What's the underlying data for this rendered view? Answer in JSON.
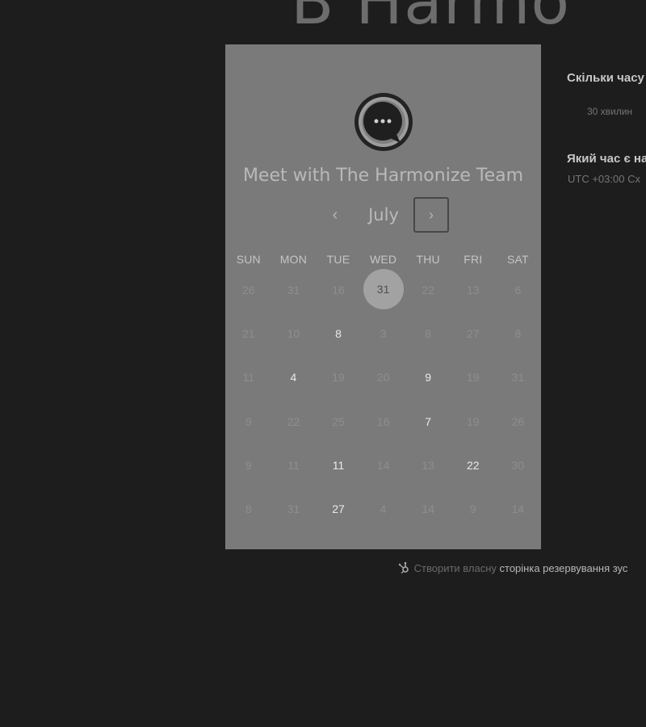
{
  "header": {
    "title_fragment": "B Harmo"
  },
  "widget": {
    "logo_icon": "chat-bubble-icon",
    "title": "Meet with The Harmonize Team",
    "month": "July",
    "prev_icon": "‹",
    "next_icon": "›",
    "weekdays": [
      "SUN",
      "MON",
      "TUE",
      "WED",
      "THU",
      "FRI",
      "SAT"
    ],
    "weeks": [
      [
        {
          "d": "26",
          "state": "disabled"
        },
        {
          "d": "31",
          "state": "disabled"
        },
        {
          "d": "16",
          "state": "disabled"
        },
        {
          "d": "31",
          "state": "selected"
        },
        {
          "d": "22",
          "state": "disabled"
        },
        {
          "d": "13",
          "state": "disabled"
        },
        {
          "d": "6",
          "state": "disabled"
        }
      ],
      [
        {
          "d": "21",
          "state": "disabled"
        },
        {
          "d": "10",
          "state": "disabled"
        },
        {
          "d": "8",
          "state": "available"
        },
        {
          "d": "3",
          "state": "disabled"
        },
        {
          "d": "8",
          "state": "disabled"
        },
        {
          "d": "27",
          "state": "disabled"
        },
        {
          "d": "8",
          "state": "disabled"
        }
      ],
      [
        {
          "d": "11",
          "state": "disabled"
        },
        {
          "d": "4",
          "state": "available"
        },
        {
          "d": "19",
          "state": "disabled"
        },
        {
          "d": "20",
          "state": "disabled"
        },
        {
          "d": "9",
          "state": "available"
        },
        {
          "d": "19",
          "state": "disabled"
        },
        {
          "d": "31",
          "state": "disabled"
        }
      ],
      [
        {
          "d": "9",
          "state": "disabled"
        },
        {
          "d": "22",
          "state": "disabled"
        },
        {
          "d": "25",
          "state": "disabled"
        },
        {
          "d": "16",
          "state": "disabled"
        },
        {
          "d": "7",
          "state": "available"
        },
        {
          "d": "19",
          "state": "disabled"
        },
        {
          "d": "26",
          "state": "disabled"
        }
      ],
      [
        {
          "d": "9",
          "state": "disabled"
        },
        {
          "d": "11",
          "state": "disabled"
        },
        {
          "d": "11",
          "state": "available"
        },
        {
          "d": "14",
          "state": "disabled"
        },
        {
          "d": "13",
          "state": "disabled"
        },
        {
          "d": "22",
          "state": "available"
        },
        {
          "d": "30",
          "state": "disabled"
        }
      ],
      [
        {
          "d": "8",
          "state": "disabled"
        },
        {
          "d": "31",
          "state": "disabled"
        },
        {
          "d": "27",
          "state": "available"
        },
        {
          "d": "4",
          "state": "disabled"
        },
        {
          "d": "14",
          "state": "disabled"
        },
        {
          "d": "9",
          "state": "disabled"
        },
        {
          "d": "14",
          "state": "disabled"
        }
      ]
    ]
  },
  "side": {
    "duration_heading": "Скільки часу",
    "duration_option": "30 хвилин",
    "time_heading": "Який час є на",
    "timezone": "UTC +03:00 Сх"
  },
  "footer": {
    "icon": "hubspot-sprocket-icon",
    "prefix": "Створити власну",
    "link": "сторінка резервування зус"
  },
  "colors": {
    "background": "#1d1d1e",
    "card": "#7a7a7a",
    "selected_circle": "#a2a2a2"
  }
}
